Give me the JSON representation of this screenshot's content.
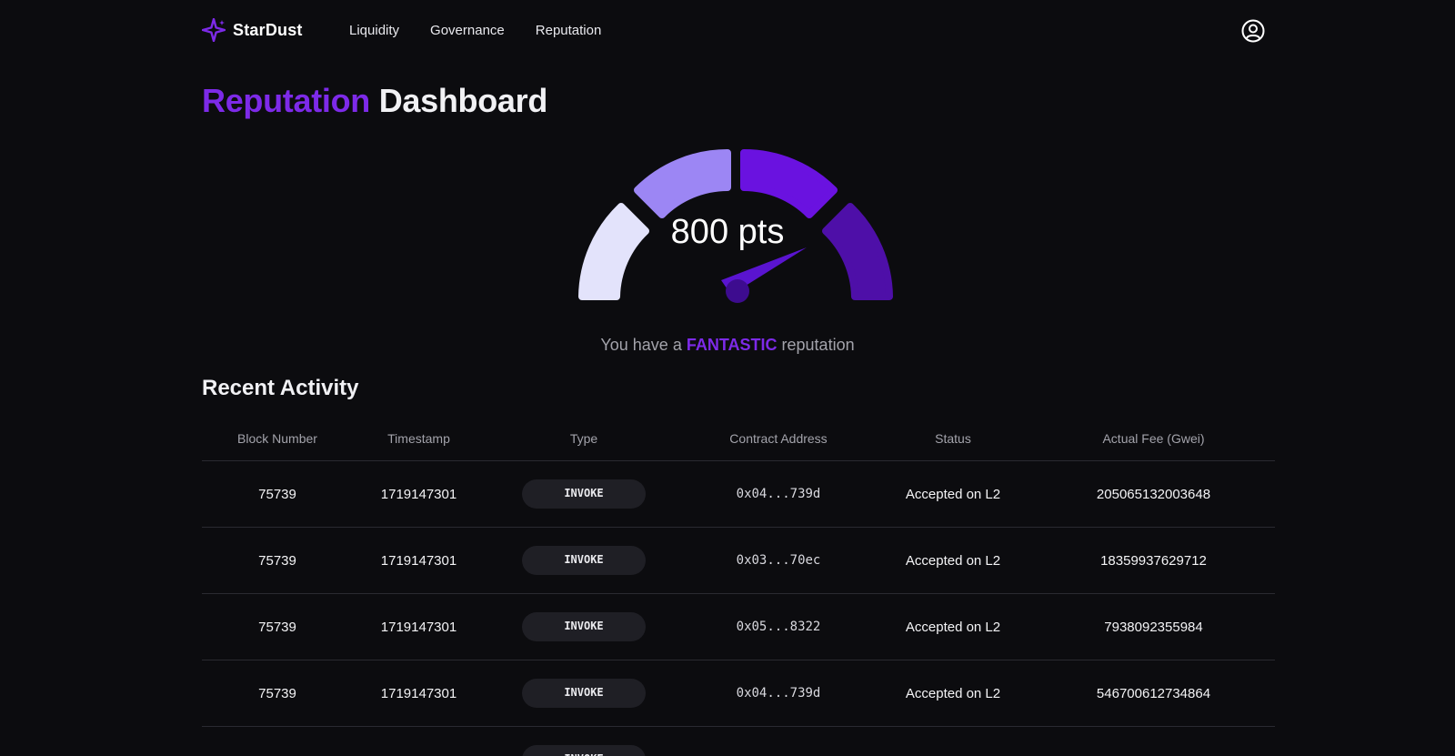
{
  "brand": {
    "name": "StarDust",
    "icon": "sparkle-icon",
    "color": "#7d2ae8"
  },
  "nav": {
    "items": [
      {
        "label": "Liquidity"
      },
      {
        "label": "Governance"
      },
      {
        "label": "Reputation"
      }
    ],
    "account_icon": "user-circle-icon"
  },
  "title": {
    "accent": "Reputation",
    "rest": "Dashboard"
  },
  "gauge": {
    "value_text": "800 pts",
    "points": 800,
    "caption_prefix": "You have a",
    "level": "FANTASTIC",
    "caption_suffix": "reputation",
    "segment_colors": [
      "#e3e3fb",
      "#9c86f4",
      "#6a12e0",
      "#4e0fa8"
    ],
    "needle_color": "#5a14d0"
  },
  "activity": {
    "title": "Recent Activity",
    "columns": [
      "Block Number",
      "Timestamp",
      "Type",
      "Contract Address",
      "Status",
      "Actual Fee (Gwei)"
    ],
    "rows": [
      {
        "block": "75739",
        "timestamp": "1719147301",
        "type": "INVOKE",
        "address": "0x04...739d",
        "status": "Accepted on L2",
        "fee": "205065132003648"
      },
      {
        "block": "75739",
        "timestamp": "1719147301",
        "type": "INVOKE",
        "address": "0x03...70ec",
        "status": "Accepted on L2",
        "fee": "18359937629712"
      },
      {
        "block": "75739",
        "timestamp": "1719147301",
        "type": "INVOKE",
        "address": "0x05...8322",
        "status": "Accepted on L2",
        "fee": "7938092355984"
      },
      {
        "block": "75739",
        "timestamp": "1719147301",
        "type": "INVOKE",
        "address": "0x04...739d",
        "status": "Accepted on L2",
        "fee": "546700612734864"
      },
      {
        "block": "",
        "timestamp": "",
        "type": "INVOKE",
        "address": "",
        "status": "",
        "fee": ""
      }
    ]
  }
}
